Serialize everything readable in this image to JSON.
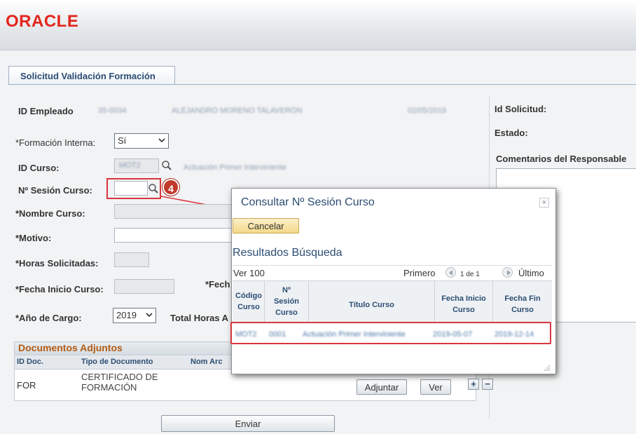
{
  "header": {
    "logo": "ORACLE"
  },
  "tab": {
    "label": "Solicitud Validación Formación"
  },
  "form": {
    "id_empleado_label": "ID Empleado",
    "id_empleado_value": "35-0034",
    "employee_name": "ALEJANDRO MORENO TALAVERON",
    "date_value": "02/05/2019",
    "formacion_interna_label": "*Formación Interna:",
    "formacion_interna_value": "Sí",
    "id_curso_label": "ID Curso:",
    "id_curso_value": "MOT2",
    "curso_desc": "Actuación Primer Interviniente",
    "sesion_curso_label": "Nº Sesión Curso:",
    "nombre_curso_label": "*Nombre Curso:",
    "motivo_label": "*Motivo:",
    "horas_solicitadas_label": "*Horas Solicitadas:",
    "fecha_inicio_label": "*Fecha Inicio Curso:",
    "fecha_fin_label": "*Fech",
    "anio_cargo_label": "*Año de Cargo:",
    "anio_cargo_value": "2019",
    "total_horas_label": "Total Horas A"
  },
  "right_panel": {
    "id_solicitud_label": "Id Solicitud:",
    "estado_label": "Estado:",
    "comentarios_label": "Comentarios del Responsable"
  },
  "documentos": {
    "title": "Documentos Adjuntos",
    "columns": [
      "ID Doc.",
      "Tipo de Documento",
      "Nom Arc"
    ],
    "rows": [
      {
        "id_doc": "FOR",
        "tipo": "CERTIFICADO DE FORMACIÓN"
      }
    ],
    "adjuntar_label": "Adjuntar",
    "ver_label": "Ver",
    "add_label": "+",
    "remove_label": "−"
  },
  "enviar_label": "Enviar",
  "annotation": {
    "step": "4"
  },
  "modal": {
    "title": "Consultar Nº Sesión Curso",
    "close_label": "×",
    "cancel_label": "Cancelar",
    "results_title": "Resultados Búsqueda",
    "view_all": "Ver 100",
    "first": "Primero",
    "page_info": "1 de 1",
    "last": "Último",
    "columns": [
      {
        "line1": "Código",
        "line2": "Curso",
        "line3": ""
      },
      {
        "line1": "Nº",
        "line2": "Sesión",
        "line3": "Curso"
      },
      {
        "line1": "Título Curso",
        "line2": "",
        "line3": ""
      },
      {
        "line1": "Fecha Inicio",
        "line2": "Curso",
        "line3": ""
      },
      {
        "line1": "Fecha Fin",
        "line2": "Curso",
        "line3": ""
      }
    ],
    "rows": [
      {
        "codigo": "MOT2",
        "sesion": "0001",
        "titulo": "Actuación Primer Interviniente",
        "fecha_inicio": "2019-05-07",
        "fecha_fin": "2019-12-14"
      }
    ]
  },
  "colors": {
    "accent": "#2c4d73",
    "oracle_red": "#e3261c",
    "highlight": "#d9363e",
    "docs_title": "#b35b13"
  }
}
